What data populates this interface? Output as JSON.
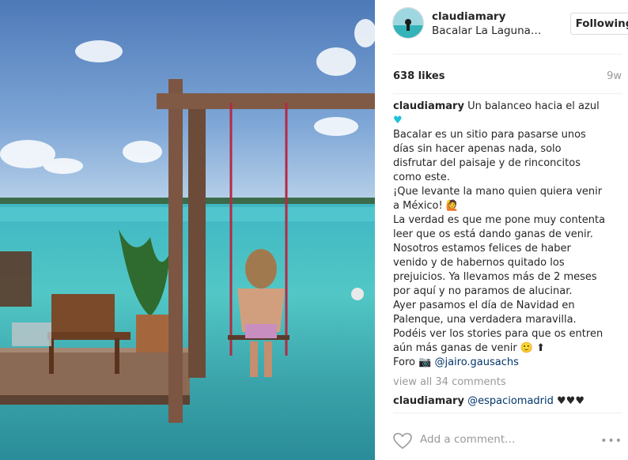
{
  "post": {
    "username": "claudiamary",
    "location": "Bacalar La Laguna…",
    "follow_label": "Following",
    "likes": "638 likes",
    "time_ago": "9w"
  },
  "caption": {
    "username": "claudiamary",
    "first_line": "Un balanceo hacia el azul",
    "heart": "♥",
    "lines": [
      "Bacalar es un sitio para pasarse unos",
      "días sin hacer apenas nada, solo",
      "disfrutar del paisaje y de rinconcitos",
      "como este.",
      "¡Que levante la mano quien quiera venir",
      "a México! 🙋",
      "La verdad es que me pone muy contenta",
      "leer que os está dando ganas de venir.",
      "Nosotros estamos felices de haber",
      "venido y de habernos quitado los",
      "prejuicios. Ya llevamos más de 2 meses",
      "por aquí y no paramos de alucinar.",
      "Ayer pasamos el día de Navidad en",
      "Palenque, una verdadera maravilla.",
      "Podéis ver los stories para que os entren",
      "aún más ganas de venir 🙂 ⬆"
    ],
    "photo_prefix": "Foro 📷",
    "photo_credit": "@jairo.gausachs"
  },
  "comments": {
    "view_all": "view all 34 comments",
    "first": {
      "username": "claudiamary",
      "mention": "@espaciomadrid",
      "hearts": "♥♥♥"
    }
  },
  "add_comment": {
    "placeholder": "Add a comment…",
    "more": "•••"
  },
  "colors": {
    "link": "#003569",
    "heart_accent": "#1ec2d8",
    "muted": "#999999"
  },
  "icons": {
    "like": "heart-outline-icon",
    "more": "more-options-icon"
  }
}
